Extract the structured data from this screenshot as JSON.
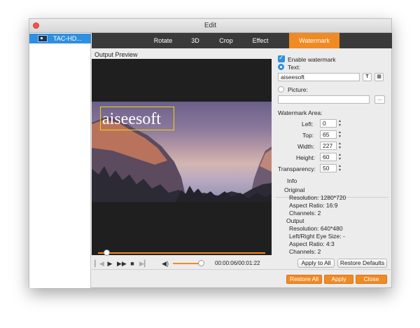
{
  "window": {
    "title": "Edit"
  },
  "sidebar": {
    "file_label": "TAC-HD..."
  },
  "tabs": [
    "Rotate",
    "3D",
    "Crop",
    "Effect",
    "Watermark"
  ],
  "active_tab": "Watermark",
  "preview": {
    "label": "Output Preview",
    "watermark_text": "aiseesoft"
  },
  "player": {
    "timecode": "00:00:06/00:01:22",
    "seek_fraction": 0.05,
    "volume_fraction": 0.95
  },
  "watermark": {
    "enable_label": "Enable watermark",
    "enabled": true,
    "text_label": "Text:",
    "text_value": "aiseesoft",
    "picture_label": "Picture:",
    "picture_value": "",
    "browse_label": "...",
    "area_label": "Watermark Area:",
    "left_label": "Left:",
    "left_value": "0",
    "top_label": "Top:",
    "top_value": "65",
    "width_label": "Width:",
    "width_value": "227",
    "height_label": "Height:",
    "height_value": "60",
    "transparency_label": "Transparency:",
    "transparency_value": "50"
  },
  "info": {
    "title": "Info",
    "original_title": "Original",
    "original_resolution": "Resolution: 1280*720",
    "original_aspect": "Aspect Ratio: 16:9",
    "original_channels": "Channels: 2",
    "output_title": "Output",
    "output_resolution": "Resolution: 640*480",
    "output_eye": "Left/Right Eye Size: -",
    "output_aspect": "Aspect Ratio: 4:3",
    "output_channels": "Channels: 2"
  },
  "buttons": {
    "apply_to_all": "Apply to All",
    "restore_defaults": "Restore Defaults",
    "restore_all": "Restore All",
    "apply": "Apply",
    "close": "Close"
  },
  "colors": {
    "accent": "#f08a24",
    "selection": "#2f8fe0",
    "watermark_box": "#f2d400"
  }
}
